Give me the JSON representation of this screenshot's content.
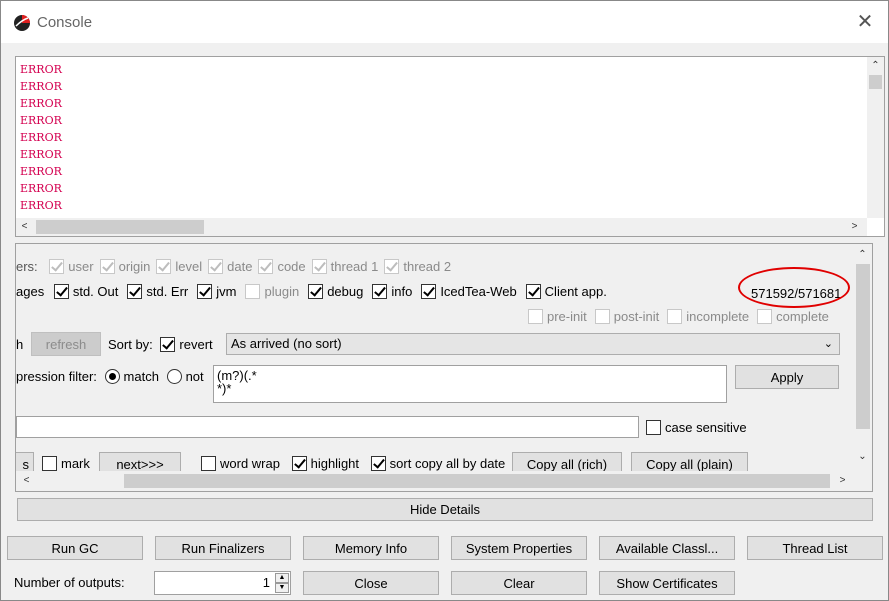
{
  "window": {
    "title": "Console",
    "close_label": "✕"
  },
  "log": {
    "lines": [
      "ERROR",
      "ERROR",
      "ERROR",
      "ERROR",
      "ERROR",
      "ERROR",
      "ERROR",
      "ERROR",
      "ERROR"
    ],
    "color": "#d40050"
  },
  "details": {
    "headers_label": "ers:",
    "headers": [
      "user",
      "origin",
      "level",
      "date",
      "code",
      "thread 1",
      "thread 2"
    ],
    "messages_label": "ages",
    "messages": [
      {
        "label": "std. Out",
        "checked": true
      },
      {
        "label": "std. Err",
        "checked": true
      },
      {
        "label": "jvm",
        "checked": true
      },
      {
        "label": "plugin",
        "checked": false,
        "disabled": true
      },
      {
        "label": "debug",
        "checked": true
      },
      {
        "label": "info",
        "checked": true
      },
      {
        "label": "IcedTea-Web",
        "checked": true
      },
      {
        "label": "Client app.",
        "checked": true
      }
    ],
    "count": "571592/571681",
    "states": [
      "pre-init",
      "post-init",
      "incomplete",
      "complete"
    ],
    "refresh_prefix": "h",
    "refresh_label": "refresh",
    "sort_label": "Sort by:",
    "revert_label": "revert",
    "sort_value": "As arrived (no sort)",
    "regex_label": "pression filter:",
    "match_label": "match",
    "not_label": "not",
    "regex_value": "(m?)(.*\n*)*",
    "apply_label": "Apply",
    "case_label": "case sensitive",
    "search_prefix": "s",
    "mark_label": "mark",
    "next_label": "next>>>",
    "word_wrap_label": "word wrap",
    "highlight_label": "highlight",
    "sort_copy_label": "sort copy all by date",
    "copy_rich_label": "Copy all (rich)",
    "copy_plain_label": "Copy all (plain)"
  },
  "hide_details_label": "Hide Details",
  "buttons": {
    "run_gc": "Run GC",
    "run_finalizers": "Run Finalizers",
    "memory_info": "Memory Info",
    "system_properties": "System Properties",
    "available_classes": "Available Classl...",
    "thread_list": "Thread List",
    "close": "Close",
    "clear": "Clear",
    "show_certificates": "Show Certificates"
  },
  "outputs": {
    "label": "Number of outputs:",
    "value": "1"
  },
  "colors": {
    "annotation": "#e00000",
    "error_text": "#d40050"
  }
}
